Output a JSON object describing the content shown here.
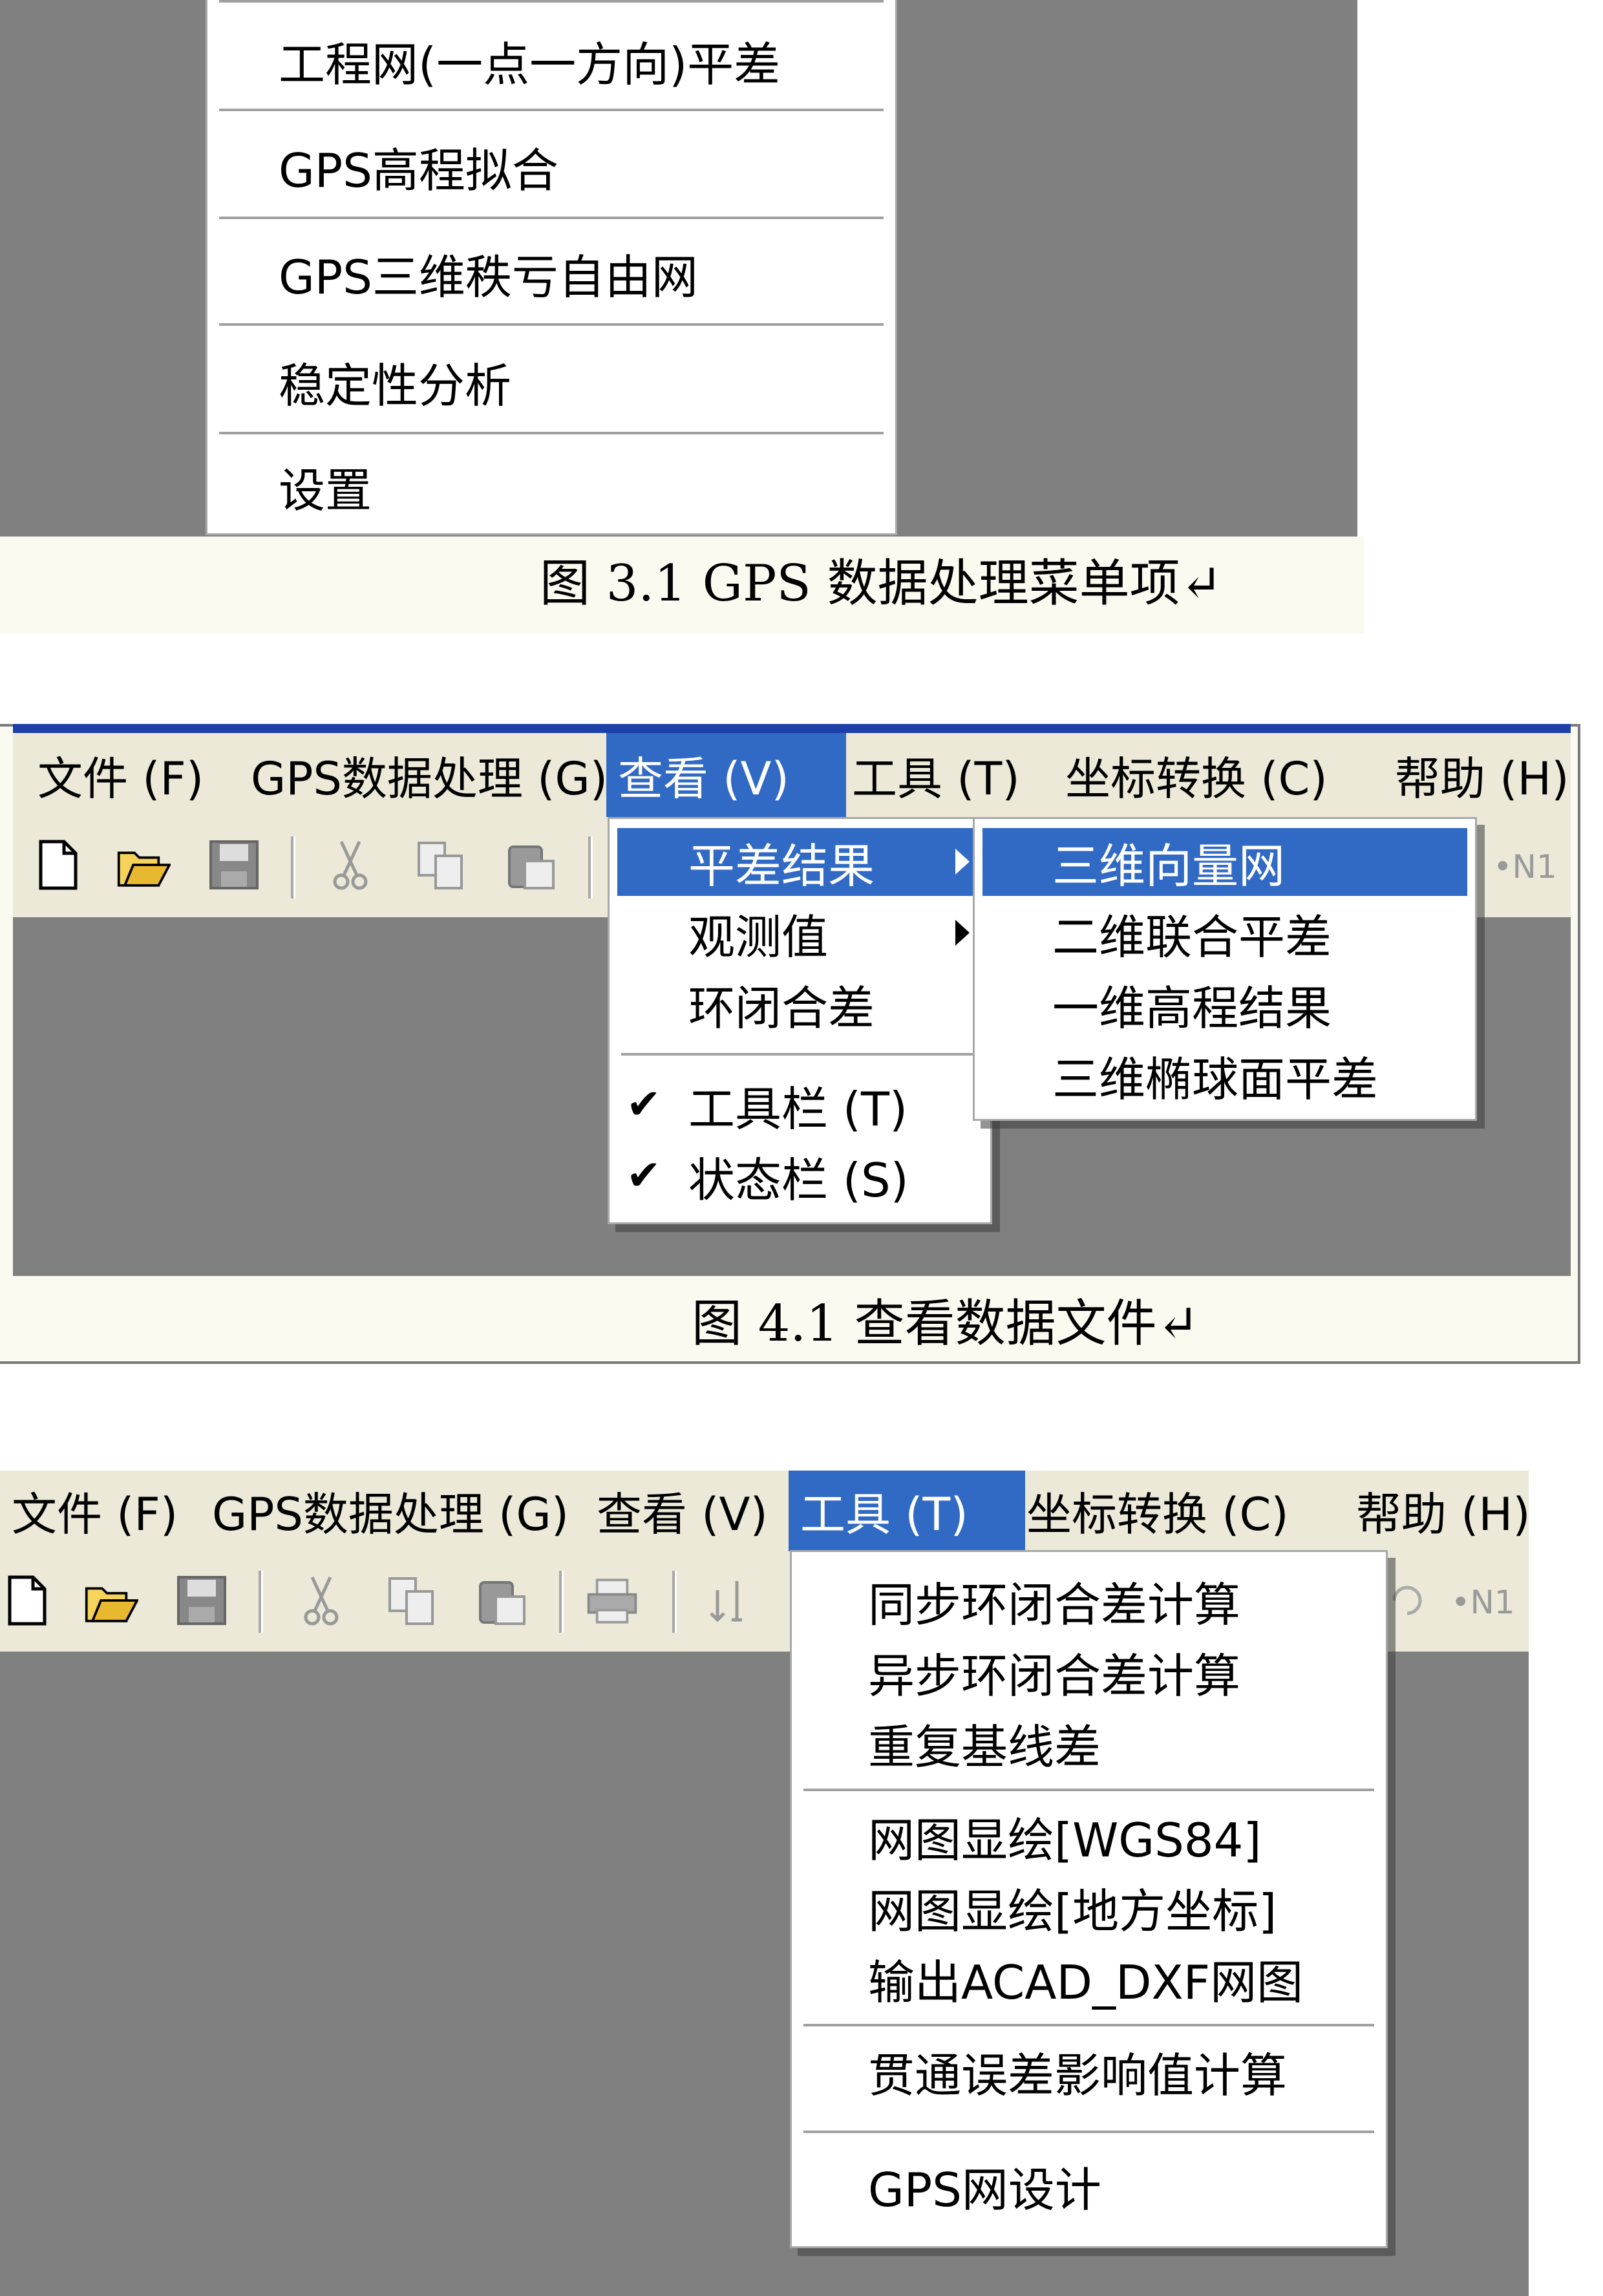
{
  "fig3": {
    "items": [
      "工程网(一点一方向)平差",
      "GPS高程拟合",
      "GPS三维秩亏自由网",
      "稳定性分析",
      "设置"
    ],
    "caption": "图 3.1 GPS 数据处理菜单项↵"
  },
  "fig4": {
    "menubar": [
      "文件 (F)",
      "GPS数据处理 (G)",
      "查看 (V)",
      "工具 (T)",
      "坐标转换 (C)",
      "帮助 (H)"
    ],
    "view_menu": {
      "items": [
        "平差结果",
        "观测值",
        "环闭合差",
        "工具栏 (T)",
        "状态栏 (S)"
      ]
    },
    "submenu": [
      "三维向量网",
      "二维联合平差",
      "一维高程结果",
      "三维椭球面平差"
    ],
    "toolbar_tail": "•N1",
    "caption": "图 4.1 查看数据文件↵"
  },
  "fig5": {
    "menubar": [
      "文件 (F)",
      "GPS数据处理 (G)",
      "查看 (V)",
      "工具 (T)",
      "坐标转换 (C)",
      "帮助 (H)"
    ],
    "tools_menu": {
      "items": [
        "同步环闭合差计算",
        "异步环闭合差计算",
        "重复基线差",
        "网图显绘[WGS84]",
        "网图显绘[地方坐标]",
        "输出ACAD_DXF网图",
        "贯通误差影响值计算",
        "GPS网设计"
      ]
    },
    "toolbar_tail": "•N1"
  },
  "colors": {
    "highlight": "#316ac5",
    "workspace": "#808080",
    "menubar": "#ece9d8"
  }
}
